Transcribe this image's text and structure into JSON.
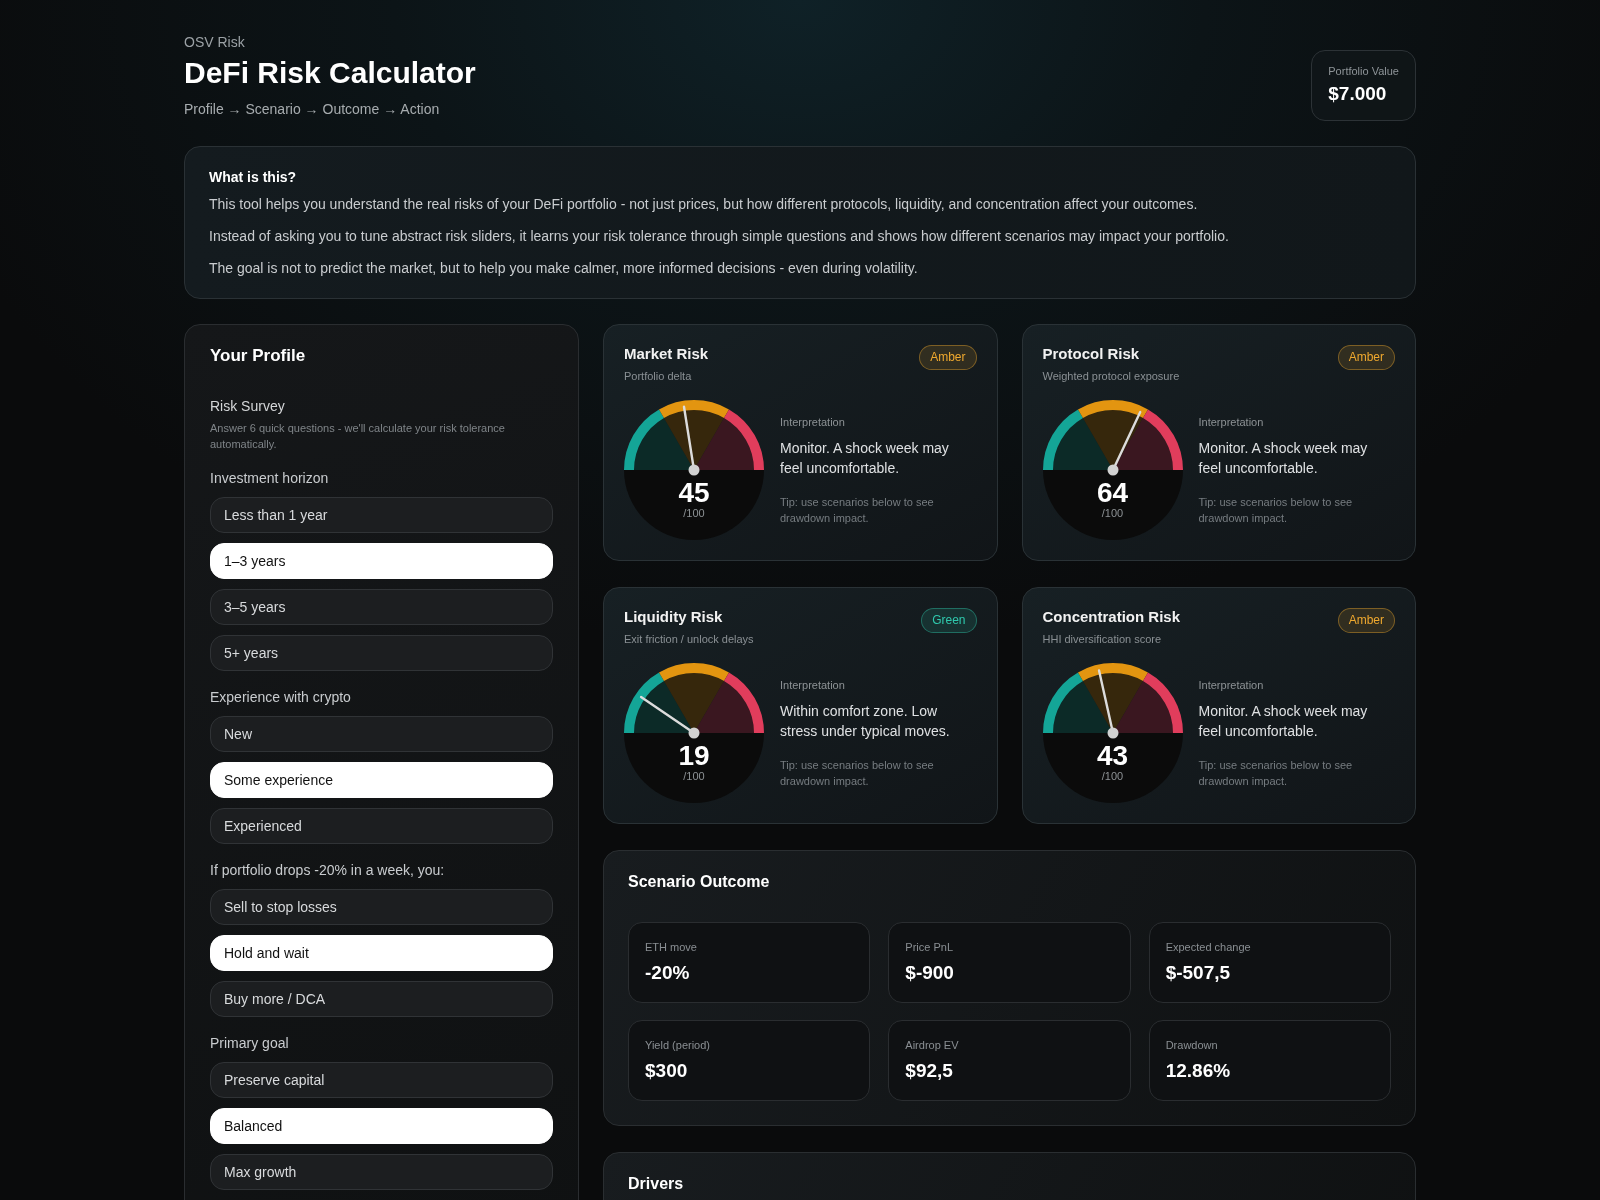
{
  "header": {
    "eyebrow": "OSV Risk",
    "title": "DeFi Risk Calculator",
    "breadcrumb": "Profile → Scenario → Outcome → Action",
    "portfolio": {
      "label": "Portfolio Value",
      "value": "$7.000"
    }
  },
  "intro": {
    "title": "What is this?",
    "paragraphs": [
      "This tool helps you understand the real risks of your DeFi portfolio - not just prices, but how different protocols, liquidity, and concentration affect your outcomes.",
      "Instead of asking you to tune abstract risk sliders, it learns your risk tolerance through simple questions and shows how different scenarios may impact your portfolio.",
      "The goal is not to predict the market, but to help you make calmer, more informed decisions - even during volatility."
    ]
  },
  "profile": {
    "title": "Your Profile",
    "survey_title": "Risk Survey",
    "survey_hint": "Answer 6 quick questions - we'll calculate your risk tolerance automatically.",
    "questions": [
      {
        "label": "Investment horizon",
        "options": [
          {
            "label": "Less than 1 year",
            "selected": false
          },
          {
            "label": "1–3 years",
            "selected": true
          },
          {
            "label": "3–5 years",
            "selected": false
          },
          {
            "label": "5+ years",
            "selected": false
          }
        ]
      },
      {
        "label": "Experience with crypto",
        "options": [
          {
            "label": "New",
            "selected": false
          },
          {
            "label": "Some experience",
            "selected": true
          },
          {
            "label": "Experienced",
            "selected": false
          }
        ]
      },
      {
        "label": "If portfolio drops -20% in a week, you:",
        "options": [
          {
            "label": "Sell to stop losses",
            "selected": false
          },
          {
            "label": "Hold and wait",
            "selected": true
          },
          {
            "label": "Buy more / DCA",
            "selected": false
          }
        ]
      },
      {
        "label": "Primary goal",
        "options": [
          {
            "label": "Preserve capital",
            "selected": false
          },
          {
            "label": "Balanced",
            "selected": true
          },
          {
            "label": "Max growth",
            "selected": false
          }
        ]
      }
    ]
  },
  "risk_cards": [
    {
      "title": "Market Risk",
      "subtitle": "Portfolio delta",
      "badge": {
        "label": "Amber",
        "color": "#f0a92e"
      },
      "gauge": {
        "level": 0.45,
        "score": "45",
        "scale": "/100"
      },
      "interpretation_label": "Interpretation",
      "interpretation": "Monitor. A shock week may feel uncomfortable.",
      "tip": "Tip: use scenarios below to see drawdown impact."
    },
    {
      "title": "Protocol Risk",
      "subtitle": "Weighted protocol exposure",
      "badge": {
        "label": "Amber",
        "color": "#f0a92e"
      },
      "gauge": {
        "level": 0.64,
        "score": "64",
        "scale": "/100"
      },
      "interpretation_label": "Interpretation",
      "interpretation": "Monitor. A shock week may feel uncomfortable.",
      "tip": "Tip: use scenarios below to see drawdown impact."
    },
    {
      "title": "Liquidity Risk",
      "subtitle": "Exit friction / unlock delays",
      "badge": {
        "label": "Green",
        "color": "#2fc9ad"
      },
      "gauge": {
        "level": 0.19,
        "score": "19",
        "scale": "/100"
      },
      "interpretation_label": "Interpretation",
      "interpretation": "Within comfort zone. Low stress under typical moves.",
      "tip": "Tip: use scenarios below to see drawdown impact."
    },
    {
      "title": "Concentration Risk",
      "subtitle": "HHI diversification score",
      "badge": {
        "label": "Amber",
        "color": "#f0a92e"
      },
      "gauge": {
        "level": 0.43,
        "score": "43",
        "scale": "/100"
      },
      "interpretation_label": "Interpretation",
      "interpretation": "Monitor. A shock week may feel uncomfortable.",
      "tip": "Tip: use scenarios below to see drawdown impact."
    }
  ],
  "scenario": {
    "title": "Scenario Outcome",
    "metrics": [
      {
        "label": "ETH move",
        "value": "-20%"
      },
      {
        "label": "Price PnL",
        "value": "$-900"
      },
      {
        "label": "Expected change",
        "value": "$-507,5"
      },
      {
        "label": "Yield (period)",
        "value": "$300"
      },
      {
        "label": "Airdrop EV",
        "value": "$92,5"
      },
      {
        "label": "Drawdown",
        "value": "12.86%"
      }
    ]
  },
  "drivers": {
    "title": "Drivers"
  }
}
